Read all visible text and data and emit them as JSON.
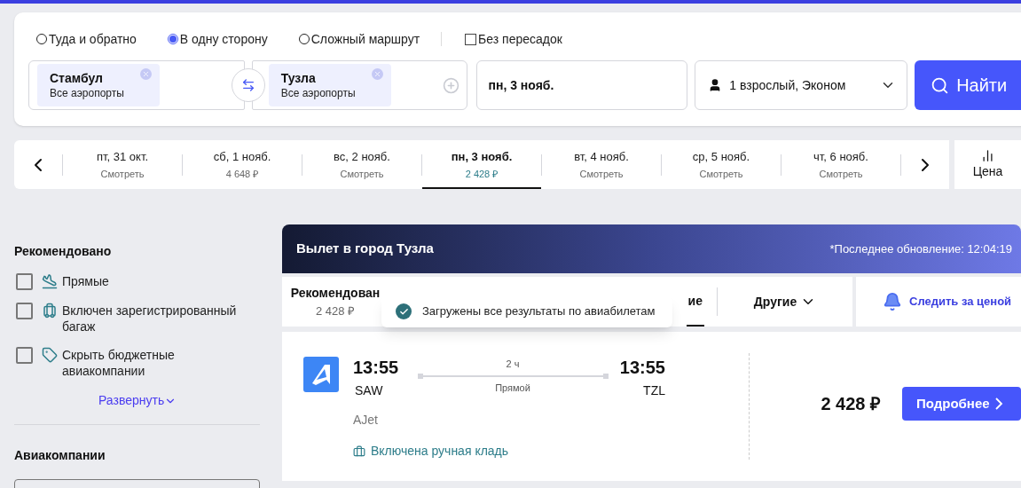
{
  "trip_types": [
    {
      "label": "Туда и обратно",
      "selected": false
    },
    {
      "label": "В одну сторону",
      "selected": true
    },
    {
      "label": "Сложный маршрут",
      "selected": false
    }
  ],
  "nonstop": {
    "label": "Без пересадок",
    "checked": false
  },
  "origin": {
    "city": "Стамбул",
    "airports": "Все аэропорты"
  },
  "destination": {
    "city": "Тузла",
    "airports": "Все аэропорты"
  },
  "date": "пн, 3 нояб.",
  "passengers": "1 взрослый, Эконом",
  "search_button": "Найти",
  "date_strip": {
    "days": [
      {
        "date": "пт, 31 окт.",
        "price": "Смотреть",
        "selected": false
      },
      {
        "date": "сб, 1 нояб.",
        "price": "4 648 ₽",
        "selected": false
      },
      {
        "date": "вс, 2 нояб.",
        "price": "Смотреть",
        "selected": false
      },
      {
        "date": "пн, 3 нояб.",
        "price": "2 428 ₽",
        "selected": true
      },
      {
        "date": "вт, 4 нояб.",
        "price": "Смотреть",
        "selected": false
      },
      {
        "date": "ср, 5 нояб.",
        "price": "Смотреть",
        "selected": false
      },
      {
        "date": "чт, 6 нояб.",
        "price": "Смотреть",
        "selected": false
      }
    ],
    "view_toggle": "Цена"
  },
  "filters": {
    "title": "Рекомендовано",
    "items": [
      {
        "kind": "direct",
        "label": "Прямые",
        "checked": false
      },
      {
        "kind": "baggage",
        "label": "Включен зарегистрированный багаж",
        "checked": false
      },
      {
        "kind": "budget",
        "label": "Скрыть бюджетные авиакомпании",
        "checked": false
      }
    ],
    "expand": "Развернуть",
    "airlines_title": "Авиакомпании"
  },
  "results": {
    "title": "Вылет в город Тузла",
    "updated": "*Последнее обновление: 12:04:19",
    "sort_tabs": [
      {
        "label": "Рекомендован",
        "price": "2 428 ₽",
        "selected": false
      },
      {
        "label": "ие",
        "selected": true
      }
    ],
    "other": "Другие",
    "watch": "Следить за ценой",
    "toast": "Загружены все результаты по авиабилетам",
    "flights": [
      {
        "dep_time": "13:55",
        "dep_code": "SAW",
        "arr_time": "13:55",
        "arr_code": "TZL",
        "duration": "2 ч",
        "stops": "Прямой",
        "airline": "AJet",
        "baggage": "Включена ручная кладь",
        "price": "2 428 ₽",
        "button": "Подробнее"
      }
    ]
  }
}
